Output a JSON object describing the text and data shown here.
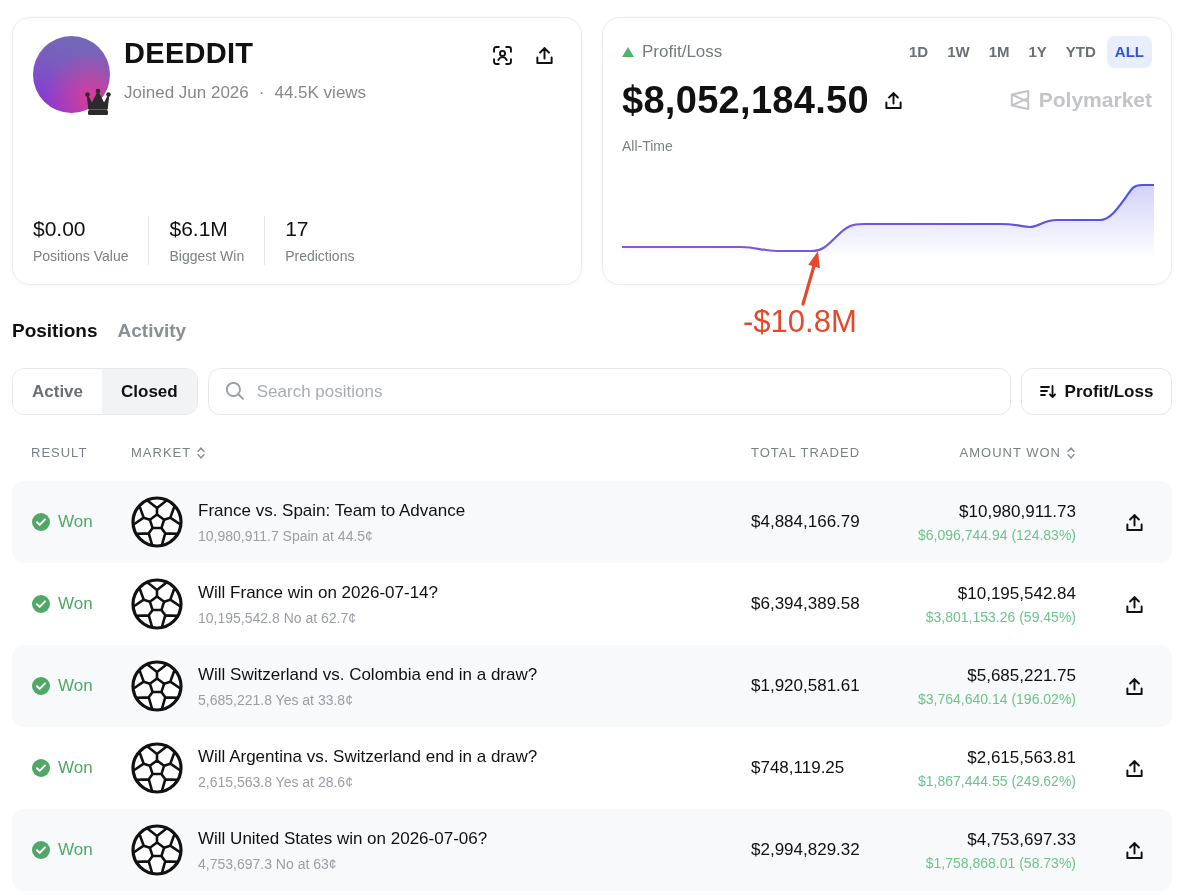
{
  "profile": {
    "name": "DEEDDIT",
    "joined": "Joined Jun 2026",
    "separator": "·",
    "views": "44.5K views",
    "stats": [
      {
        "value": "$0.00",
        "label": "Positions Value"
      },
      {
        "value": "$6.1M",
        "label": "Biggest Win"
      },
      {
        "value": "17",
        "label": "Predictions"
      }
    ]
  },
  "pnl": {
    "label": "Profit/Loss",
    "rising": true,
    "ranges": [
      {
        "label": "1D",
        "selected": false
      },
      {
        "label": "1W",
        "selected": false
      },
      {
        "label": "1M",
        "selected": false
      },
      {
        "label": "1Y",
        "selected": false
      },
      {
        "label": "YTD",
        "selected": false
      },
      {
        "label": "ALL",
        "selected": true
      }
    ],
    "value": "$8,052,184.50",
    "brand": "Polymarket",
    "period": "All-Time"
  },
  "annotation": {
    "text": "-$10.8M"
  },
  "tabs": [
    {
      "label": "Positions",
      "selected": true
    },
    {
      "label": "Activity",
      "selected": false
    }
  ],
  "filters": [
    {
      "label": "Active",
      "selected": false
    },
    {
      "label": "Closed",
      "selected": true
    }
  ],
  "search": {
    "placeholder": "Search positions"
  },
  "sort_button": {
    "label": "Profit/Loss"
  },
  "table": {
    "columns": [
      {
        "label": "RESULT",
        "sortable": false
      },
      {
        "label": "MARKET",
        "sortable": true
      },
      {
        "label": "TOTAL TRADED",
        "sortable": false
      },
      {
        "label": "AMOUNT WON",
        "sortable": true
      }
    ],
    "rows": [
      {
        "won": true,
        "result": "Won",
        "market": "France vs. Spain: Team to Advance",
        "detail": "10,980,911.7 Spain at 44.5¢",
        "total_traded": "$4,884,166.79",
        "amount_won": "$10,980,911.73",
        "profit": "$6,096,744.94 (124.83%)"
      },
      {
        "won": true,
        "result": "Won",
        "market": "Will France win on 2026-07-14?",
        "detail": "10,195,542.8 No at 62.7¢",
        "total_traded": "$6,394,389.58",
        "amount_won": "$10,195,542.84",
        "profit": "$3,801,153.26 (59.45%)"
      },
      {
        "won": true,
        "result": "Won",
        "market": "Will Switzerland vs. Colombia end in a draw?",
        "detail": "5,685,221.8 Yes at 33.8¢",
        "total_traded": "$1,920,581.61",
        "amount_won": "$5,685,221.75",
        "profit": "$3,764,640.14 (196.02%)"
      },
      {
        "won": true,
        "result": "Won",
        "market": "Will Argentina vs. Switzerland end in a draw?",
        "detail": "2,615,563.8 Yes at 28.6¢",
        "total_traded": "$748,119.25",
        "amount_won": "$2,615,563.81",
        "profit": "$1,867,444.55 (249.62%)"
      },
      {
        "won": true,
        "result": "Won",
        "market": "Will United States win on 2026-07-06?",
        "detail": "4,753,697.3 No at 63¢",
        "total_traded": "$2,994,829.32",
        "amount_won": "$4,753,697.33",
        "profit": "$1,758,868.01 (58.73%)"
      }
    ]
  }
}
